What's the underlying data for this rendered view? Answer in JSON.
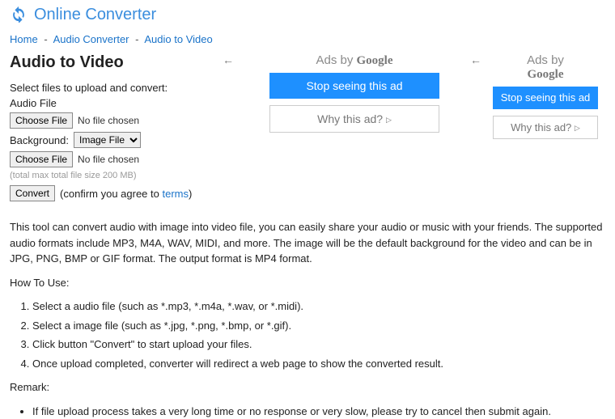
{
  "header": {
    "site_title": "Online Converter"
  },
  "breadcrumb": {
    "home": "Home",
    "audio_converter": "Audio Converter",
    "current": "Audio to Video",
    "sep": "-"
  },
  "page": {
    "title": "Audio to Video",
    "select_prompt": "Select files to upload and convert:",
    "audio_file_label": "Audio File",
    "choose_file": "Choose File",
    "no_file": "No file chosen",
    "background_label": "Background:",
    "background_value": "Image File",
    "size_hint": "(total max total file size 200 MB)",
    "convert_label": "Convert",
    "confirm_prefix": "(confirm you agree to ",
    "terms": "terms",
    "confirm_suffix": ")"
  },
  "ads": {
    "ads_by": "Ads by ",
    "google": "Google",
    "stop": "Stop seeing this ad",
    "why": "Why this ad?",
    "close": "←"
  },
  "content": {
    "intro": "This tool can convert audio with image into video file, you can easily share your audio or music with your friends. The supported audio formats include MP3, M4A, WAV, MIDI, and more. The image will be the default background for the video and can be in JPG, PNG, BMP or GIF format. The output format is MP4 format.",
    "howto_title": "How To Use:",
    "steps": [
      "Select a audio file (such as *.mp3, *.m4a, *.wav, or *.midi).",
      "Select a image file (such as *.jpg, *.png, *.bmp, or *.gif).",
      "Click button \"Convert\" to start upload your files.",
      "Once upload completed, converter will redirect a web page to show the converted result."
    ],
    "remark_title": "Remark:",
    "remarks": [
      "If file upload process takes a very long time or no response or very slow, please try to cancel then submit again."
    ]
  }
}
